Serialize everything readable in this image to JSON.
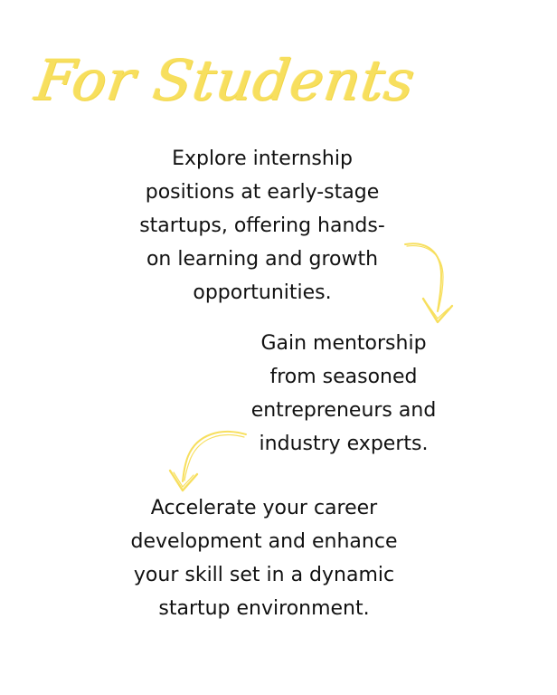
{
  "title": "For Students",
  "blocks": [
    {
      "lines": [
        "Explore internship",
        "positions at early-stage",
        "startups, offering hands-",
        "on learning and growth",
        "opportunities."
      ]
    },
    {
      "lines": [
        "Gain mentorship",
        "from seasoned",
        "entrepreneurs and",
        "industry experts."
      ]
    },
    {
      "lines": [
        "Accelerate your career",
        "development and enhance",
        "your skill set in a dynamic",
        "startup environment."
      ]
    }
  ],
  "colors": {
    "accent": "#f7df5e",
    "text": "#111111",
    "background": "#ffffff"
  },
  "icons": [
    "curved-arrow-down-right-icon",
    "curved-arrow-down-left-icon"
  ]
}
